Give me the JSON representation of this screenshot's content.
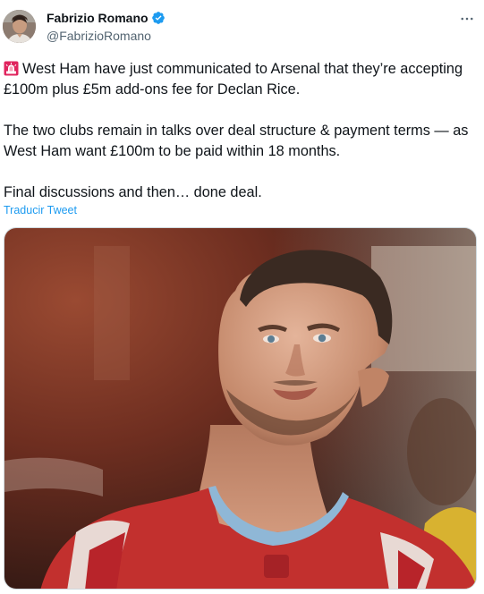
{
  "author": {
    "display_name": "Fabrizio Romano",
    "handle": "@FabrizioRomano",
    "verified": true,
    "avatar_icon": "profile-avatar"
  },
  "tweet": {
    "paragraph_1": "West Ham have just communicated to Arsenal that they’re accepting £100m plus £5m add-ons fee for Declan Rice.",
    "paragraph_2": "The two clubs remain in talks over deal structure & payment terms — as West Ham want £100m to be paid within 18 months.",
    "paragraph_3": "Final discussions and then… done deal.",
    "leading_emoji": "siren-light-emoji"
  },
  "translate_label": "Traducir Tweet",
  "media": {
    "type": "photo",
    "subject": "player-portrait-photo"
  },
  "colors": {
    "link_blue": "#1d9bf0",
    "verified_blue": "#1d9bf0",
    "text": "#0f1419",
    "secondary_text": "#536471",
    "emoji_red": "#e0245e"
  }
}
